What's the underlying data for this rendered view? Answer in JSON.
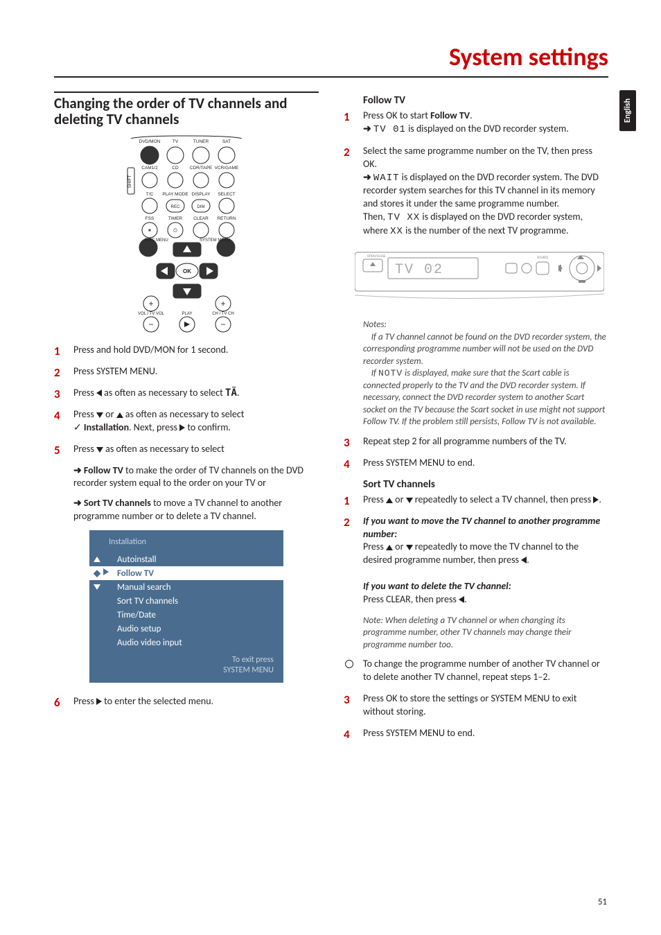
{
  "page": {
    "title": "System settings",
    "lang_tab": "English",
    "number": "51"
  },
  "left": {
    "heading": "Changing the order of TV channels and deleting TV channels",
    "remote_labels": {
      "row1": [
        "DVD/MON",
        "TV",
        "TUNER",
        "SAT"
      ],
      "row2_side": "SHIFT",
      "row2": [
        "CAM1/2",
        "CD",
        "CDR/TAPE",
        "VCR/GAME"
      ],
      "row3": [
        "T/C",
        "PLAY MODE",
        "DISPLAY",
        "SELECT"
      ],
      "row3_btn": [
        "REC",
        "DIM"
      ],
      "row4": [
        "FSS",
        "TIMER",
        "CLEAR",
        "RETURN"
      ],
      "row_menu_l": "DISC MENU",
      "row_menu_r": "SYSTEM MENU",
      "ok": "OK",
      "bottom_l": "VOL / TV VOL",
      "bottom_c": "PLAY",
      "bottom_r": "CH / TV CH"
    },
    "step1": "Press and hold DVD/MON for 1 second.",
    "step2": "Press SYSTEM MENU.",
    "step3_a": "Press ",
    "step3_b": " as often as necessary to select ",
    "step3_icon": "TÄ",
    "step3_c": ".",
    "step4_a": "Press ",
    "step4_b": " or ",
    "step4_c": " as often as necessary to select",
    "step4_bold": "Installation",
    "step4_d": ". Next, press ",
    "step4_e": " to confirm.",
    "step5_a": "Press ",
    "step5_b": " as often as necessary to select",
    "step5_f_lead": "Follow TV",
    "step5_f_txt": " to make the order of TV channels on the DVD recorder system equal to the order on your TV or",
    "step5_s_lead": "Sort TV channels",
    "step5_s_txt": " to move a TV channel to another programme number or to delete a TV channel.",
    "menu": {
      "title": "Installation",
      "items": [
        "Autoinstall",
        "Follow TV",
        "Manual search",
        "Sort TV channels",
        "Time/Date",
        "Audio setup",
        "Audio video input"
      ],
      "selected_index": 1,
      "footer1": "To exit press",
      "footer2": "SYSTEM MENU"
    },
    "step6_a": "Press ",
    "step6_b": " to enter the selected menu."
  },
  "right": {
    "follow_h": "Follow TV",
    "f1_a": "Press OK to start ",
    "f1_b": "Follow TV",
    "f1_c": ".",
    "f1_res_seg": "TV 01",
    "f1_res_txt": " is displayed on the DVD recorder system.",
    "f2_a": "Select the same programme number on the TV, then press OK.",
    "f2_res_seg": "WAIT",
    "f2_res_txt": " is displayed on the DVD recorder system. The DVD recorder system searches for this TV channel in its memory and stores it under the same programme number.",
    "f2_then_a": "Then, ",
    "f2_then_seg": "TV XX",
    "f2_then_b": " is displayed on the DVD recorder system, where ",
    "f2_then_seg2": "XX",
    "f2_then_c": " is the number of the next TV programme.",
    "device_display": "TV 02",
    "device_labels": {
      "open": "OPEN/CLOSE",
      "source": "SOURCE"
    },
    "notes_h": "Notes:",
    "notes1": "If a TV channel cannot be found on the DVD recorder system, the corresponding programme number will not be used on the DVD recorder system.",
    "notes2_a": "If ",
    "notes2_seg": "NOTV",
    "notes2_b": " is displayed, make sure that the Scart cable is connected properly to the TV and the DVD recorder system. If necessary, connect the DVD recorder system to another Scart socket on the TV because the Scart socket in use might not support Follow TV. If the problem still persists, Follow TV is not available.",
    "f3": "Repeat step 2 for all programme numbers of the TV.",
    "f4": "Press SYSTEM MENU to end.",
    "sort_h": "Sort TV channels",
    "s1_a": "Press ",
    "s1_b": " or ",
    "s1_c": " repeatedly to select a TV channel, then press ",
    "s1_d": ".",
    "s2_h": "If you want to move the TV channel to another programme number:",
    "s2_a": "Press ",
    "s2_b": " or ",
    "s2_c": " repeatedly to move the TV channel to the desired programme number, then press ",
    "s2_d": ".",
    "s2del_h": "If you want to delete the TV channel:",
    "s2del_a": "Press CLEAR, then press ",
    "s2del_b": ".",
    "s_note": "Note: When deleting a TV channel or when changing its programme number, other TV channels may change their programme number too.",
    "s_o": "To change the programme number of another TV channel or to delete another TV channel, repeat steps 1–2.",
    "s3": "Press OK to store the settings or SYSTEM MENU to exit without storing.",
    "s4": "Press SYSTEM MENU to end."
  }
}
